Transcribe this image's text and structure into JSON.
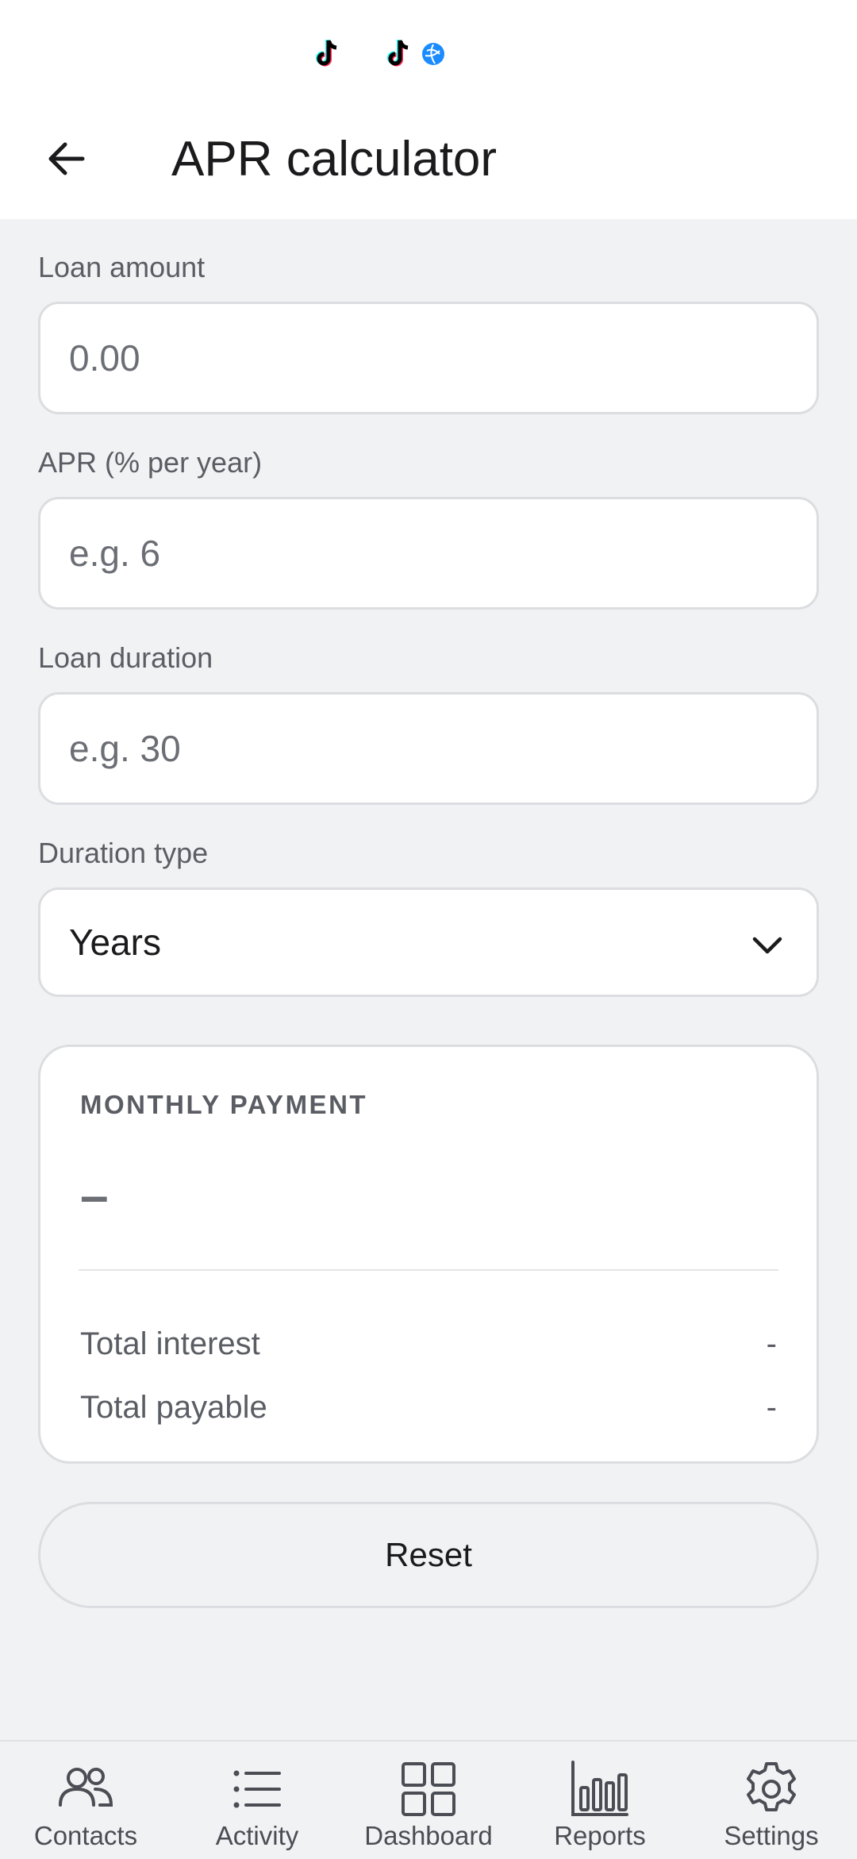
{
  "status_bar": {
    "icons": [
      "tiktok-icon",
      "tiktok-icon",
      "globe-icon"
    ]
  },
  "header": {
    "back_icon": "arrow-left-icon",
    "title": "APR calculator"
  },
  "form": {
    "loan_amount": {
      "label": "Loan amount",
      "value": "",
      "placeholder": "0.00"
    },
    "apr": {
      "label": "APR (% per year)",
      "value": "",
      "placeholder": "e.g. 6"
    },
    "duration": {
      "label": "Loan duration",
      "value": "",
      "placeholder": "e.g. 30"
    },
    "duration_type": {
      "label": "Duration type",
      "selected": "Years",
      "icon": "chevron-down-icon"
    }
  },
  "result": {
    "heading": "MONTHLY PAYMENT",
    "monthly_payment": "–",
    "rows": [
      {
        "label": "Total interest",
        "value": "-"
      },
      {
        "label": "Total payable",
        "value": "-"
      }
    ]
  },
  "actions": {
    "reset_label": "Reset"
  },
  "bottom_nav": {
    "items": [
      {
        "label": "Contacts",
        "icon": "people-icon"
      },
      {
        "label": "Activity",
        "icon": "list-icon"
      },
      {
        "label": "Dashboard",
        "icon": "grid-icon"
      },
      {
        "label": "Reports",
        "icon": "bar-chart-icon"
      },
      {
        "label": "Settings",
        "icon": "gear-icon"
      }
    ]
  },
  "colors": {
    "background": "#f1f2f4",
    "surface": "#ffffff",
    "border": "#dcdde0",
    "text_primary": "#1b1b1d",
    "text_secondary": "#5a5d63"
  }
}
